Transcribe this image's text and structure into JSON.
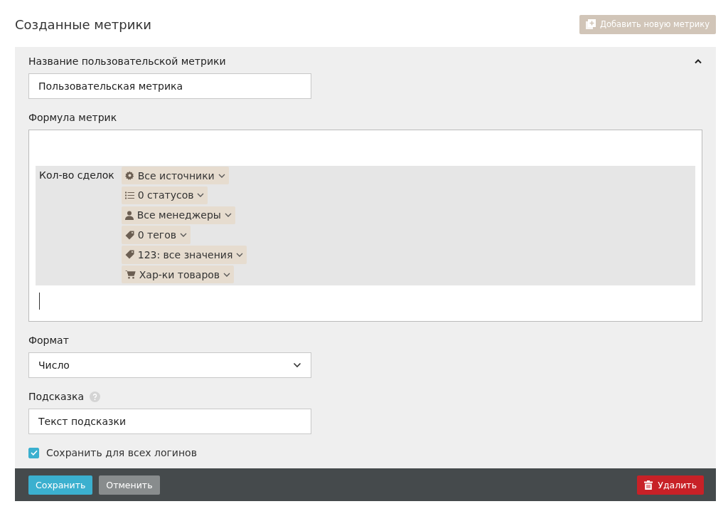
{
  "header": {
    "title": "Созданные метрики",
    "add_button": {
      "label": "Добавить новую метрику",
      "disabled": true
    }
  },
  "panel": {
    "expanded": true,
    "name_field": {
      "label": "Название пользовательской метрики",
      "value": "Пользовательская метрика"
    },
    "formula": {
      "label": "Формула метрик",
      "metric": "Кол-во сделок",
      "filters": [
        {
          "kind": "gear",
          "label": "Все источники"
        },
        {
          "kind": "list",
          "label": "0 статусов"
        },
        {
          "kind": "person",
          "label": "Все менеджеры"
        },
        {
          "kind": "tag",
          "label": "0 тегов"
        },
        {
          "kind": "tag",
          "label": "123: все значения"
        },
        {
          "kind": "cart",
          "label": "Хар-ки товаров"
        }
      ]
    },
    "format": {
      "label": "Формат",
      "value": "Число"
    },
    "hint": {
      "label": "Подсказка",
      "value": "Текст подсказки"
    },
    "save_all": {
      "label": "Сохранить для всех логинов",
      "checked": true
    }
  },
  "footer": {
    "save": "Сохранить",
    "cancel": "Отменить",
    "delete": "Удалить"
  }
}
